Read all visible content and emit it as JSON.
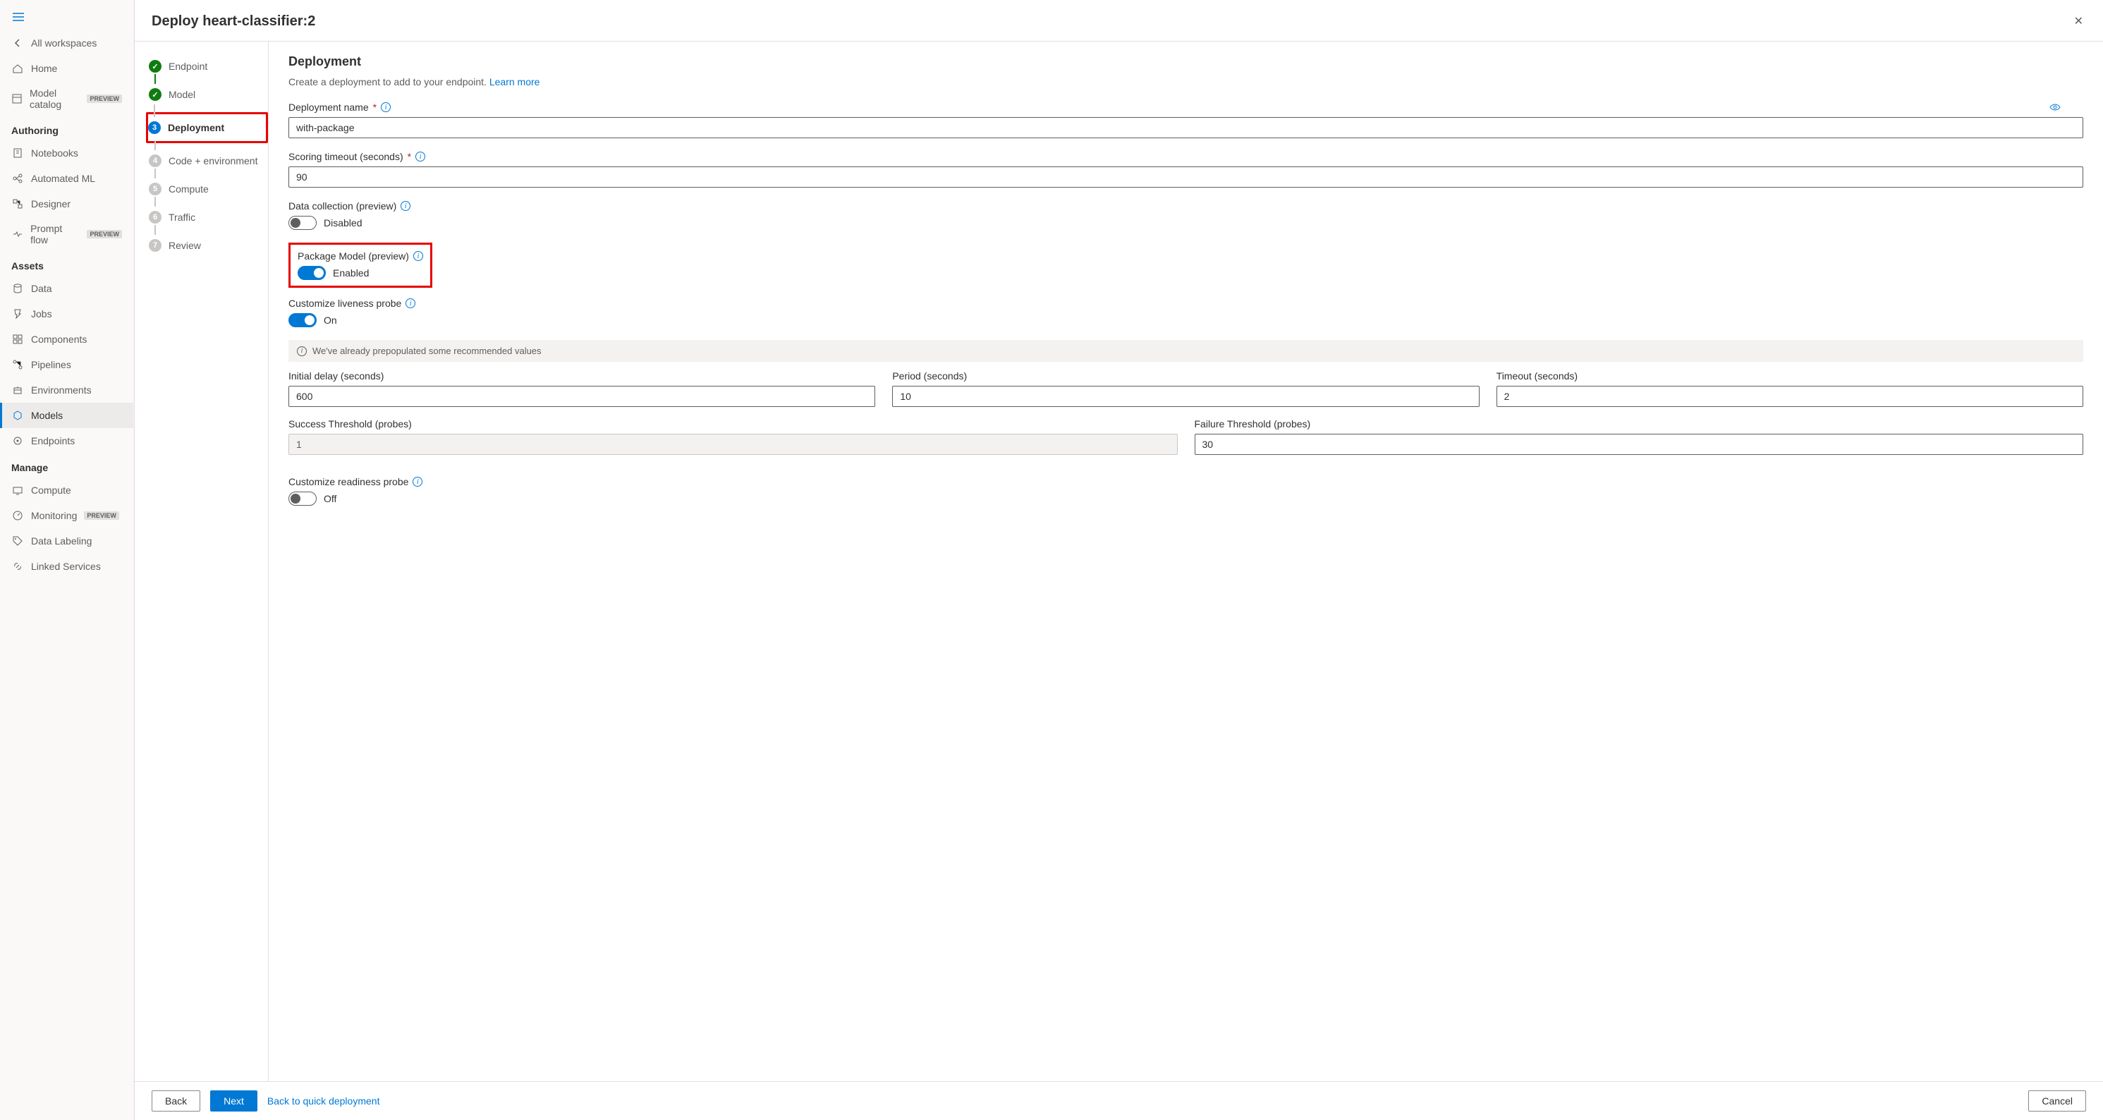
{
  "sidebar": {
    "all_workspaces": "All workspaces",
    "home": "Home",
    "model_catalog": "Model catalog",
    "preview_badge": "PREVIEW",
    "section_authoring": "Authoring",
    "notebooks": "Notebooks",
    "automated_ml": "Automated ML",
    "designer": "Designer",
    "prompt_flow": "Prompt flow",
    "section_assets": "Assets",
    "data": "Data",
    "jobs": "Jobs",
    "components": "Components",
    "pipelines": "Pipelines",
    "environments": "Environments",
    "models": "Models",
    "endpoints": "Endpoints",
    "section_manage": "Manage",
    "compute": "Compute",
    "monitoring": "Monitoring",
    "data_labeling": "Data Labeling",
    "linked_services": "Linked Services"
  },
  "panel": {
    "title": "Deploy heart-classifier:2"
  },
  "wizard": {
    "steps": {
      "endpoint": "Endpoint",
      "model": "Model",
      "deployment": "Deployment",
      "code_env": "Code + environment",
      "compute": "Compute",
      "traffic": "Traffic",
      "review": "Review"
    }
  },
  "form": {
    "heading": "Deployment",
    "description": "Create a deployment to add to your endpoint. ",
    "learn_more": "Learn more",
    "deployment_name_label": "Deployment name",
    "deployment_name_value": "with-package",
    "scoring_timeout_label": "Scoring timeout (seconds)",
    "scoring_timeout_value": "90",
    "data_collection_label": "Data collection (preview)",
    "data_collection_state": "Disabled",
    "package_model_label": "Package Model (preview)",
    "package_model_state": "Enabled",
    "liveness_label": "Customize liveness probe",
    "liveness_state": "On",
    "prepop_banner": "We've already prepopulated some recommended values",
    "initial_delay_label": "Initial delay (seconds)",
    "initial_delay_value": "600",
    "period_label": "Period (seconds)",
    "period_value": "10",
    "timeout_label": "Timeout (seconds)",
    "timeout_value": "2",
    "success_threshold_label": "Success Threshold (probes)",
    "success_threshold_value": "1",
    "failure_threshold_label": "Failure Threshold (probes)",
    "failure_threshold_value": "30",
    "readiness_label": "Customize readiness probe",
    "readiness_state": "Off"
  },
  "footer": {
    "back": "Back",
    "next": "Next",
    "back_to_quick": "Back to quick deployment",
    "cancel": "Cancel"
  }
}
